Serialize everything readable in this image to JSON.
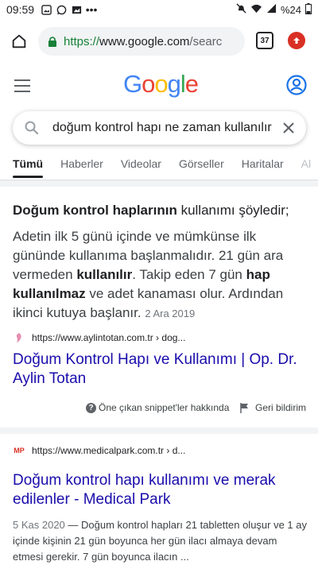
{
  "status_bar": {
    "time": "09:59",
    "battery": "%24"
  },
  "browser": {
    "url_scheme": "https://",
    "url_host": "www.google.com",
    "url_rest": "/searc",
    "tab_count": "37"
  },
  "google": {
    "logo_letters": [
      "G",
      "o",
      "o",
      "g",
      "l",
      "e"
    ],
    "logo_colors": [
      "#4285F4",
      "#EA4335",
      "#FBBC05",
      "#4285F4",
      "#34A853",
      "#EA4335"
    ],
    "query": "doğum kontrol hapı ne zaman kullanılır"
  },
  "tabs": [
    "Tümü",
    "Haberler",
    "Videolar",
    "Görseller",
    "Haritalar",
    "Al"
  ],
  "featured_snippet": {
    "heading_bold": "Doğum kontrol haplarının",
    "heading_rest": " kullanımı şöyledir;",
    "body_part1": "Adetin ilk 5 günü içinde ve mümkünse ilk gününde kullanıma başlanmalıdır. 21 gün ara vermeden ",
    "body_bold1": "kullanılır",
    "body_part2": ". Takip eden 7 gün ",
    "body_bold2": "hap kullanılmaz",
    "body_part3": " ve adet kanaması olur. Ardından ikinci kutuya başlanır.",
    "date": "2 Ara 2019",
    "source_url": "https://www.aylintotan.com.tr › dog...",
    "title": "Doğum Kontrol Hapı ve Kullanımı | Op. Dr. Aylin Totan",
    "about_label": "Öne çıkan snippet'ler hakkında",
    "feedback_label": "Geri bildirim"
  },
  "result2": {
    "favicon_text": "MP",
    "source_url": "https://www.medicalpark.com.tr › d...",
    "title": "Doğum kontrol hapı kullanımı ve merak edilenler - Medical Park",
    "date": "5 Kas 2020",
    "snippet": " — Doğum kontrol hapları 21 tabletten oluşur ve 1 ay içinde kişinin 21 gün boyunca her gün ilacı almaya devam etmesi gerekir. 7 gün boyunca ilacın ..."
  },
  "colors": {
    "link": "#1a0dab",
    "url_green": "#188038",
    "accent_blue": "#1a73e8",
    "update_red": "#d93025"
  }
}
